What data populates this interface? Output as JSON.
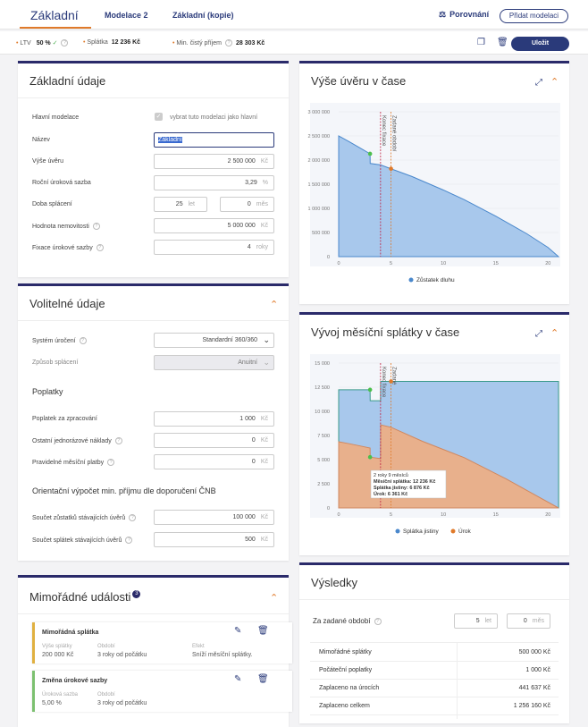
{
  "tabs": {
    "active": "Základní",
    "t2": "Modelace 2",
    "t3": "Základní (kopie)",
    "compare": "Porovnání",
    "add": "Přidat modelaci"
  },
  "stats": {
    "ltv_label": "LTV",
    "ltv_value": "50 %",
    "payment_label": "Splátka",
    "payment_value": "12 236 Kč",
    "income_label": "Min. čistý příjem",
    "income_value": "28 303 Kč",
    "save": "Uložit"
  },
  "basic": {
    "title": "Základní údaje",
    "main_label": "Hlavní modelace",
    "main_check": "vybrat tuto modelaci jako hlavní",
    "name_label": "Název",
    "name_value": "Základní",
    "amount_label": "Výše úvěru",
    "amount_value": "2 500 000",
    "amount_unit": "Kč",
    "rate_label": "Roční úroková sazba",
    "rate_value": "3,29",
    "rate_unit": "%",
    "term_label": "Doba splácení",
    "term_years": "25",
    "term_years_unit": "let",
    "term_months": "0",
    "term_months_unit": "měs",
    "property_label": "Hodnota nemovitosti",
    "property_value": "5 000 000",
    "property_unit": "Kč",
    "fix_label": "Fixace úrokové sazby",
    "fix_value": "4",
    "fix_unit": "roky"
  },
  "optional": {
    "title": "Volitelné údaje",
    "system_label": "Systém úročení",
    "system_value": "Standardní 360/360",
    "method_label": "Způsob splácení",
    "method_value": "Anuitní",
    "fees_title": "Poplatky",
    "fee1_label": "Poplatek za zpracování",
    "fee1_value": "1 000",
    "fee2_label": "Ostatní jednorázové náklady",
    "fee2_value": "0",
    "fee3_label": "Pravidelné měsíční platby",
    "fee3_value": "0",
    "unit": "Kč",
    "income_title": "Orientační výpočet min. příjmu dle doporučení ČNB",
    "inc1_label": "Součet zůstatků stávajících úvěrů",
    "inc1_value": "100 000",
    "inc2_label": "Součet splátek stávajících úvěrů",
    "inc2_value": "500"
  },
  "events": {
    "title": "Mimořádné události",
    "count": "3",
    "e1_title": "Mimořádná splátka",
    "e1_k1": "Výše splátky",
    "e1_v1": "200 000 Kč",
    "e1_k2": "Období",
    "e1_v2": "3 roky od počátku",
    "e1_k3": "Efekt",
    "e1_v3": "Sníží měsíční splátky.",
    "e2_title": "Změna úrokové sazby",
    "e2_k1": "Úroková sazba",
    "e2_v1": "5,00 %",
    "e2_k2": "Období",
    "e2_v2": "3 roky od počátku"
  },
  "results": {
    "title": "Výsledky",
    "period_label": "Za zadané období",
    "period_years": "5",
    "period_years_unit": "let",
    "period_months": "0",
    "period_months_unit": "měs",
    "rows": [
      {
        "label": "Mimořádné splátky",
        "value": "500 000 Kč"
      },
      {
        "label": "Počáteční poplatky",
        "value": "1 000 Kč"
      },
      {
        "label": "Zaplaceno na úrocích",
        "value": "441 637 Kč"
      },
      {
        "label": "Zaplaceno celkem",
        "value": "1 256 160 Kč"
      }
    ]
  },
  "chart1": {
    "title": "Výše úvěru v čase",
    "legend": "Zůstatek dluhu",
    "ann1": "Konec fixace",
    "ann2": "Zadané období"
  },
  "chart2": {
    "title": "Vývoj měsíční splátky v čase",
    "legend1": "Splátka jistiny",
    "legend2": "Úrok",
    "ann1": "Konec fixace",
    "ann2": "Zadané",
    "tt1": "2 roky 9 měsíců",
    "tt2": "Měsíční splátka: 12 236 Kč",
    "tt3": "Splátka jistiny: 6 876 Kč",
    "tt4": "Úrok: 6 361 Kč"
  },
  "chart_data": [
    {
      "type": "area",
      "title": "Výše úvěru v čase",
      "x_ticks": [
        "0",
        "5",
        "10",
        "15",
        "20"
      ],
      "y_ticks": [
        "0",
        "500 000",
        "1 000 000",
        "1 500 000",
        "2 000 000",
        "2 500 000",
        "3 000 000"
      ],
      "ylim": [
        0,
        3000000
      ],
      "xlim": [
        0,
        21
      ],
      "series": [
        {
          "name": "Zůstatek dluhu",
          "x": [
            0,
            1,
            2,
            3,
            3.01,
            4,
            5,
            7,
            10,
            12,
            15,
            18,
            20,
            21
          ],
          "values": [
            2500000,
            2380000,
            2255000,
            2130000,
            1930000,
            1900000,
            1820000,
            1660000,
            1380000,
            1180000,
            840000,
            470000,
            190000,
            0
          ]
        }
      ],
      "markers": [
        {
          "x": 3,
          "y": 2130000
        },
        {
          "x": 5,
          "y": 1820000
        }
      ],
      "vlines": [
        {
          "x": 4,
          "label": "Konec fixace"
        },
        {
          "x": 5,
          "label": "Zadané období"
        }
      ]
    },
    {
      "type": "area",
      "title": "Vývoj měsíční splátky v čase",
      "x_ticks": [
        "0",
        "5",
        "10",
        "15",
        "20"
      ],
      "y_ticks": [
        "0",
        "2 500",
        "5 000",
        "7 500",
        "10 000",
        "12 500",
        "15 000"
      ],
      "ylim": [
        0,
        15000
      ],
      "xlim": [
        0,
        21
      ],
      "series": [
        {
          "name": "Splátka jistiny",
          "x": [
            0,
            3,
            3.01,
            4,
            4.01,
            21,
            21.01
          ],
          "values": [
            12236,
            12236,
            11100,
            11100,
            13100,
            13100,
            10200
          ]
        },
        {
          "name": "Úrok",
          "x": [
            0,
            1,
            2,
            3,
            3.01,
            4,
            4.01,
            5,
            8,
            12,
            16,
            19,
            21
          ],
          "values": [
            6850,
            6650,
            6430,
            6200,
            5260,
            5100,
            8600,
            8350,
            6900,
            5200,
            3000,
            1200,
            0
          ]
        }
      ],
      "markers": [
        {
          "x": 3,
          "y": 12236
        },
        {
          "x": 3,
          "y": 5260
        },
        {
          "x": 5,
          "y": 13100
        }
      ],
      "vlines": [
        {
          "x": 4,
          "label": "Konec fixace"
        },
        {
          "x": 5,
          "label": "Zadané"
        }
      ]
    }
  ]
}
